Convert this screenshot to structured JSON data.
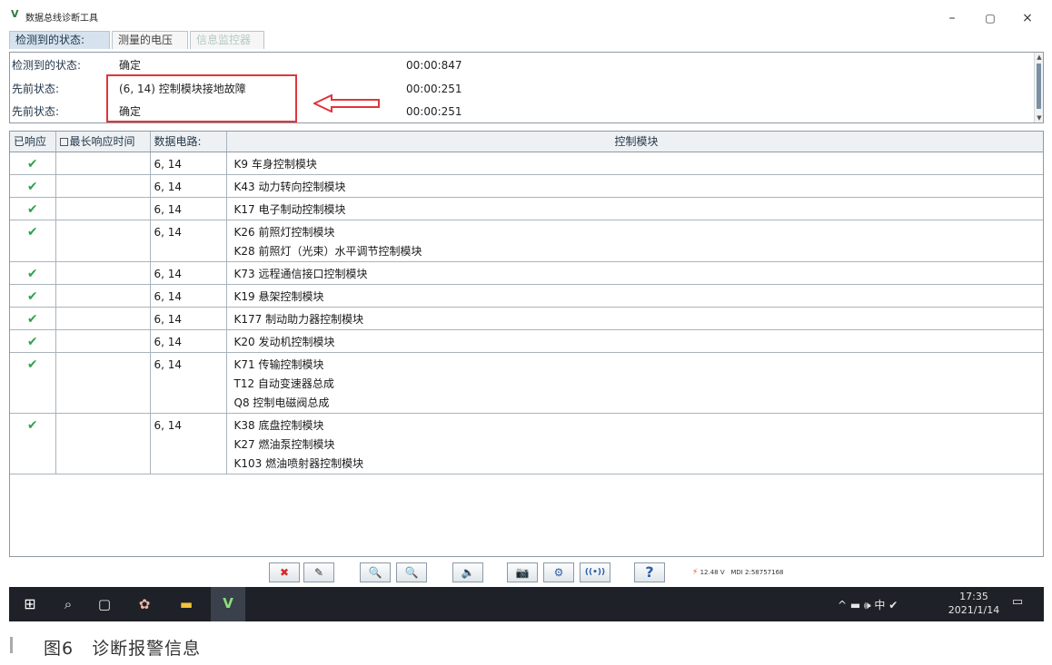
{
  "window": {
    "logo": "V",
    "title": "数据总线诊断工具",
    "minimize": "–",
    "maximize": "▢",
    "close": "×"
  },
  "tabs": [
    {
      "label": "检测到的状态:"
    },
    {
      "label": "测量的电压"
    },
    {
      "label": "信息监控器"
    }
  ],
  "status": [
    {
      "label": "检测到的状态:",
      "value": "确定",
      "time": "00:00:847"
    },
    {
      "label": "先前状态:",
      "value": "(6, 14) 控制模块接地故障",
      "time": "00:00:251"
    },
    {
      "label": "先前状态:",
      "value": "确定",
      "time": "00:00:251"
    }
  ],
  "table": {
    "headers": {
      "responded": "已响应",
      "max_time": "最长响应时间",
      "circuit": "数据电路:",
      "modules": "控制模块"
    },
    "rows": [
      {
        "ok": "✔",
        "circuit": "6, 14",
        "modules": [
          "K9 车身控制模块"
        ]
      },
      {
        "ok": "✔",
        "circuit": "6, 14",
        "modules": [
          "K43 动力转向控制模块"
        ]
      },
      {
        "ok": "✔",
        "circuit": "6, 14",
        "modules": [
          "K17 电子制动控制模块"
        ]
      },
      {
        "ok": "✔",
        "circuit": "6, 14",
        "modules": [
          "K26 前照灯控制模块",
          "K28 前照灯（光束）水平调节控制模块"
        ]
      },
      {
        "ok": "✔",
        "circuit": "6, 14",
        "modules": [
          "K73 远程通信接口控制模块"
        ]
      },
      {
        "ok": "✔",
        "circuit": "6, 14",
        "modules": [
          "K19 悬架控制模块"
        ]
      },
      {
        "ok": "✔",
        "circuit": "6, 14",
        "modules": [
          "K177 制动助力器控制模块"
        ]
      },
      {
        "ok": "✔",
        "circuit": "6, 14",
        "modules": [
          "K20 发动机控制模块"
        ]
      },
      {
        "ok": "✔",
        "circuit": "6, 14",
        "modules": [
          "K71 传输控制模块",
          "T12 自动变速器总成",
          "Q8 控制电磁阀总成"
        ]
      },
      {
        "ok": "✔",
        "circuit": "6, 14",
        "modules": [
          "K38 底盘控制模块",
          "K27 燃油泵控制模块",
          "K103 燃油喷射器控制模块"
        ]
      }
    ]
  },
  "toolbar": {
    "icons": [
      "close-x-icon",
      "eraser-icon",
      "zoom-in-icon",
      "zoom-out-icon",
      "speaker-icon",
      "camera-icon",
      "gear-icon",
      "wireless-icon",
      "help-icon"
    ],
    "glyphs": {
      "close": "✖",
      "erase": "✎",
      "zoom_in": "🔍",
      "zoom_out": "🔍",
      "speaker": "🔈",
      "camera": "📷",
      "gear": "⚙",
      "wireless": "((•))",
      "help": "?"
    },
    "voltage_icon": "⚡",
    "voltage": "12.48 V",
    "device_id": "MDI 2:58757168"
  },
  "taskbar": {
    "start": "⊞",
    "search": "⌕",
    "task_view": "▢",
    "app1": "✿",
    "app2": "▬",
    "app3": "V",
    "tray": "^ ▬ 🕪 中 ✔",
    "time": "17:35",
    "date": "2021/1/14",
    "notify": "▭"
  },
  "caption": "图6　诊断报警信息",
  "colors": {
    "highlight": "#e0353a",
    "check": "#2fa44a",
    "taskbar": "#1e2127"
  }
}
